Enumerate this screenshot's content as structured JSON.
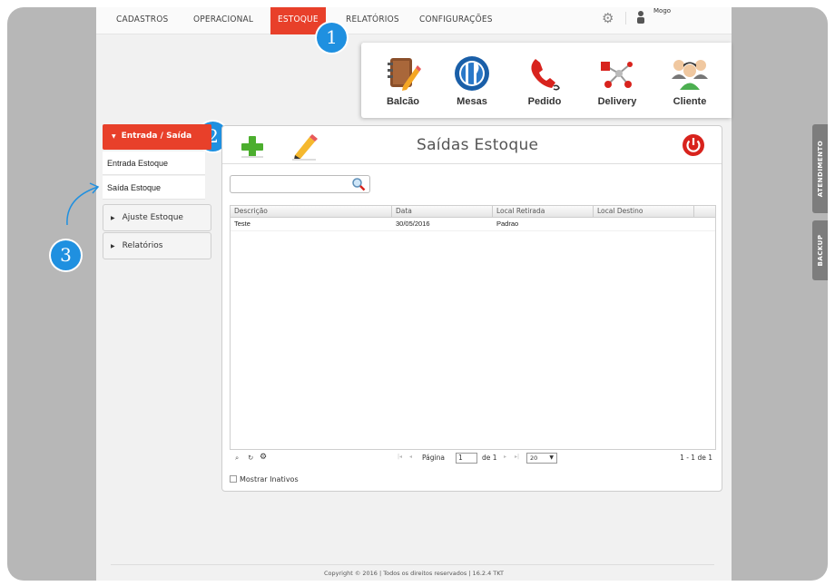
{
  "nav": {
    "items": [
      "CADASTROS",
      "OPERACIONAL",
      "ESTOQUE",
      "RELATÓRIOS",
      "CONFIGURAÇÕES"
    ],
    "active": "ESTOQUE",
    "user": "Mogo"
  },
  "quick": {
    "items": [
      {
        "label": "Balcão",
        "icon": "notebook-pencil-icon"
      },
      {
        "label": "Mesas",
        "icon": "cutlery-icon"
      },
      {
        "label": "Pedido",
        "icon": "phone-icon"
      },
      {
        "label": "Delivery",
        "icon": "network-icon"
      },
      {
        "label": "Cliente",
        "icon": "users-icon"
      }
    ]
  },
  "badges": {
    "one": "1",
    "two": "2",
    "three": "3"
  },
  "sidebar": {
    "header": "Entrada / Saída",
    "links": [
      "Entrada Estoque",
      "Saída Estoque"
    ],
    "groups": [
      "Ajuste Estoque",
      "Relatórios"
    ]
  },
  "panel": {
    "title": "Saídas Estoque",
    "search_value": "",
    "columns": [
      "Descrição",
      "Data",
      "Local Retirada",
      "Local Destino"
    ],
    "rows": [
      {
        "descricao": "Teste",
        "data": "30/05/2016",
        "local_retirada": "Padrao",
        "local_destino": ""
      }
    ],
    "pager": {
      "label": "Página",
      "page": "1",
      "of": "de 1",
      "page_size": "20",
      "summary": "1 - 1 de 1"
    },
    "checkbox_label": "Mostrar Inativos"
  },
  "footer": "Copyright © 2016 | Todos os direitos reservados | 16.2.4 TKT",
  "side_tabs": [
    "ATENDIMENTO",
    "BACKUP"
  ],
  "colors": {
    "accent": "#e8402a",
    "badge": "#1f90e0",
    "frame": "#b7b7b7"
  }
}
